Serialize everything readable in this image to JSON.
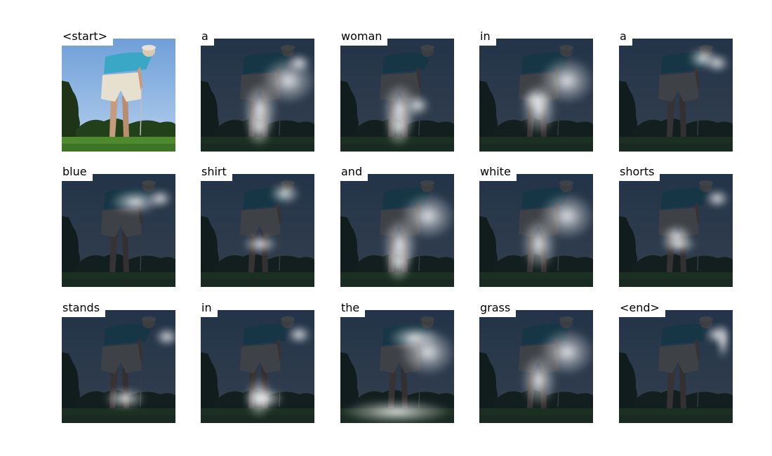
{
  "caption_words": [
    "<start>",
    "a",
    "woman",
    "in",
    "a",
    "blue",
    "shirt",
    "and",
    "white",
    "shorts",
    "stands",
    "in",
    "the",
    "grass",
    "<end>"
  ],
  "colors": {
    "sky": "#8ab4e2",
    "grass": "#4f8a2f",
    "shirt": "#3aa7c6",
    "shorts": "#e7e0cf",
    "trees": "#1f3416",
    "dim_overlay": "#0e1620",
    "attention_glow": "#ffffff"
  },
  "attention": [
    {
      "word": "<start>",
      "focus": [],
      "dim": false
    },
    {
      "word": "a",
      "focus": [
        "legs-lower",
        "legs",
        "head-right",
        "upper-right"
      ],
      "dim": true
    },
    {
      "word": "woman",
      "focus": [
        "legs-lower",
        "legs",
        "hands"
      ],
      "dim": true
    },
    {
      "word": "in",
      "focus": [
        "knees",
        "legs",
        "upper-right"
      ],
      "dim": true
    },
    {
      "word": "a",
      "focus": [
        "head-right",
        "head"
      ],
      "dim": true
    },
    {
      "word": "blue",
      "focus": [
        "shirt",
        "head-right"
      ],
      "dim": true
    },
    {
      "word": "shirt",
      "focus": [
        "shorts-bottom",
        "head"
      ],
      "dim": true
    },
    {
      "word": "and",
      "focus": [
        "legs-lower",
        "legs",
        "upper-right"
      ],
      "dim": true
    },
    {
      "word": "white",
      "focus": [
        "legs",
        "upper-right"
      ],
      "dim": true
    },
    {
      "word": "shorts",
      "focus": [
        "shorts-bottom",
        "knees",
        "head-right"
      ],
      "dim": true
    },
    {
      "word": "stands",
      "focus": [
        "feet",
        "right-edge"
      ],
      "dim": true
    },
    {
      "word": "in",
      "focus": [
        "legs-lower",
        "feet",
        "head-right"
      ],
      "dim": true
    },
    {
      "word": "the",
      "focus": [
        "grass",
        "upper-right",
        "shirt"
      ],
      "dim": true
    },
    {
      "word": "grass",
      "focus": [
        "upper-right",
        "legs"
      ],
      "dim": true
    },
    {
      "word": "<end>",
      "focus": [
        "far-right",
        "head-right"
      ],
      "dim": true
    }
  ]
}
